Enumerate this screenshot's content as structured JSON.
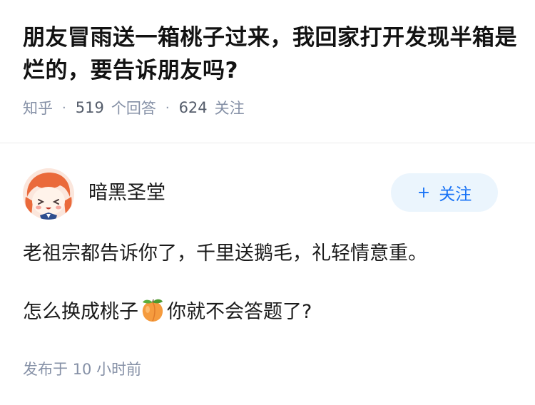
{
  "question": {
    "title": "朋友冒雨送一箱桃子过来，我回家打开发现半箱是烂的，要告诉朋友吗?",
    "source": "知乎",
    "answers_count": "519",
    "answers_label": "个回答",
    "followers_count": "624",
    "followers_label": "关注"
  },
  "author": {
    "name": "暗黑圣堂",
    "follow_label": "关注",
    "avatar_icon": "anime-girl-avatar-icon"
  },
  "answer": {
    "para1": "老祖宗都告诉你了，千里送鹅毛，礼轻情意重。",
    "para2_before": "怎么换成桃子",
    "para2_emoji": "peach-emoji-icon",
    "para2_after": "你就不会答题了?"
  },
  "footer": {
    "published_prefix": "发布于",
    "published_time": "10 小时前"
  },
  "colors": {
    "brand_blue": "#1772f6",
    "button_bg": "#ebf5fd",
    "meta_gray": "#8590a6"
  }
}
